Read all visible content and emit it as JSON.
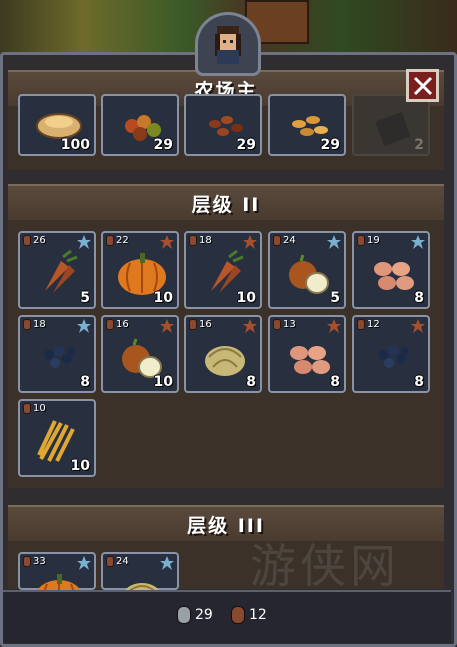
{
  "header": {
    "title": "农场主"
  },
  "tier2": {
    "title": "层级 II"
  },
  "tier3": {
    "title": "层级 III"
  },
  "top_row": [
    {
      "name": "bread-icon",
      "count": "100"
    },
    {
      "name": "berries-icon",
      "count": "29"
    },
    {
      "name": "beans-icon",
      "count": "29"
    },
    {
      "name": "peanuts-icon",
      "count": "29"
    },
    {
      "name": "locked-item-icon",
      "count": "2"
    }
  ],
  "tier2_items": [
    {
      "icon": "carrot-icon",
      "level": "26",
      "count": "5",
      "star": "blue",
      "coin": "bronze"
    },
    {
      "icon": "pumpkin-icon",
      "level": "22",
      "count": "10",
      "star": "bronze",
      "coin": "bronze"
    },
    {
      "icon": "carrot-icon",
      "level": "18",
      "count": "10",
      "star": "bronze",
      "coin": "bronze"
    },
    {
      "icon": "onion-icon",
      "level": "24",
      "count": "5",
      "star": "blue",
      "coin": "bronze"
    },
    {
      "icon": "potato-icon",
      "level": "19",
      "count": "8",
      "star": "blue",
      "coin": "bronze"
    },
    {
      "icon": "blueberry-icon",
      "level": "18",
      "count": "8",
      "star": "blue",
      "coin": "bronze"
    },
    {
      "icon": "onion-icon",
      "level": "16",
      "count": "10",
      "star": "bronze",
      "coin": "bronze"
    },
    {
      "icon": "cabbage-icon",
      "level": "16",
      "count": "8",
      "star": "bronze",
      "coin": "bronze"
    },
    {
      "icon": "potato-icon",
      "level": "13",
      "count": "8",
      "star": "bronze",
      "coin": "bronze"
    },
    {
      "icon": "blueberry-icon",
      "level": "12",
      "count": "8",
      "star": "bronze",
      "coin": "bronze"
    },
    {
      "icon": "wheat-icon",
      "level": "10",
      "count": "10",
      "star": "",
      "coin": "bronze"
    }
  ],
  "tier3_items": [
    {
      "icon": "pumpkin-icon",
      "level": "33",
      "star": "blue",
      "coin": "bronze"
    },
    {
      "icon": "cabbage-icon",
      "level": "24",
      "star": "blue",
      "coin": "bronze"
    }
  ],
  "footer": {
    "silver": "29",
    "bronze": "12"
  },
  "watermark": "游侠网",
  "colors": {
    "slot_border": "#8a93a6",
    "close_bg": "#7a1e1e",
    "header_bg": "#4a3b30"
  }
}
